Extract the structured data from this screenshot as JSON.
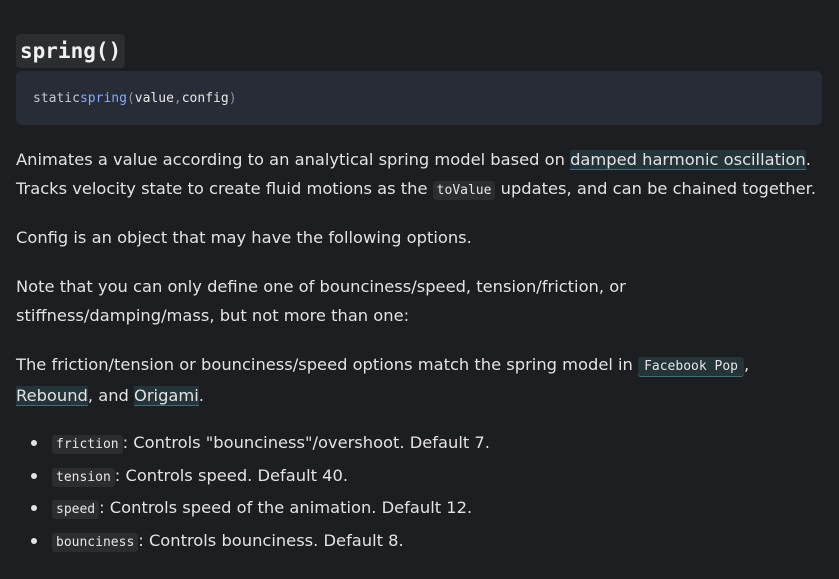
{
  "heading": {
    "title": "spring()"
  },
  "signature": {
    "keyword": "static",
    "function": "spring",
    "open_paren": "(",
    "param1": "value",
    "comma": ",",
    "param2": "config",
    "close_paren": ")"
  },
  "para1": {
    "text1": "Animates a value according to an analytical spring model based on ",
    "link": "damped harmonic oscillation",
    "text2": ". Tracks velocity state to create fluid motions as the ",
    "code": "toValue",
    "text3": " updates, and can be chained together."
  },
  "para2": {
    "text": "Config is an object that may have the following options."
  },
  "para3": {
    "text": "Note that you can only define one of bounciness/speed, tension/friction, or stiffness/damping/mass, but not more than one:"
  },
  "para4": {
    "text1": "The friction/tension or bounciness/speed options match the spring model in ",
    "link_facebook_pop": "Facebook Pop",
    "sep1": ", ",
    "link_rebound": "Rebound",
    "sep2": ", and ",
    "link_origami": "Origami",
    "end": "."
  },
  "options": [
    {
      "code": "friction",
      "desc": ": Controls \"bounciness\"/overshoot. Default 7."
    },
    {
      "code": "tension",
      "desc": ": Controls speed. Default 40."
    },
    {
      "code": "speed",
      "desc": ": Controls speed of the animation. Default 12."
    },
    {
      "code": "bounciness",
      "desc": ": Controls bounciness. Default 8."
    }
  ],
  "colors": {
    "background": "#1c1e21",
    "code_block": "#282c36",
    "function_name": "#82aaff",
    "link_highlight": "#243438"
  }
}
